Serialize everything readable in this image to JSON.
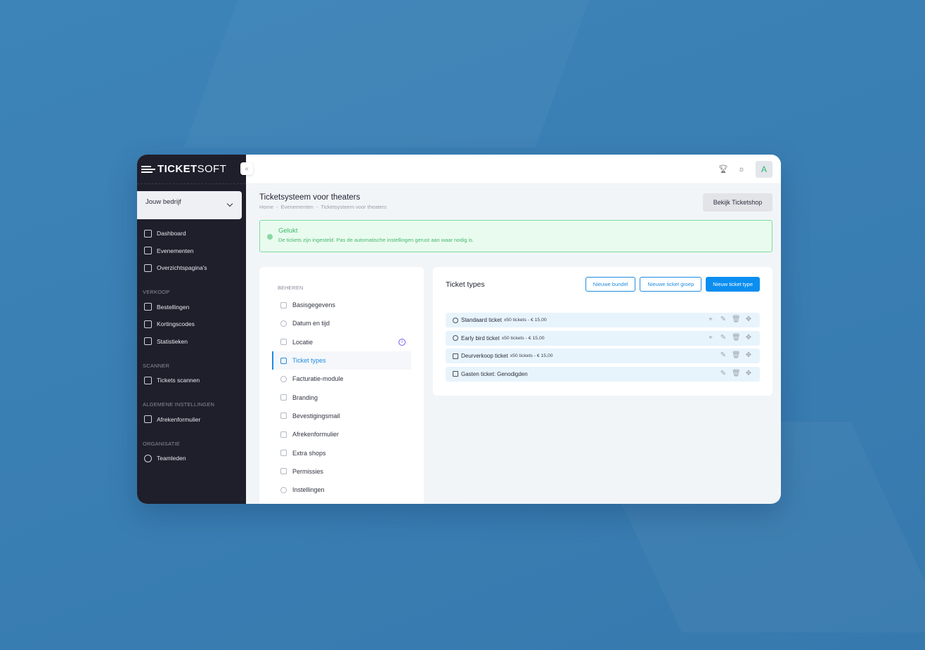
{
  "app": {
    "logo_bold": "TICKET",
    "logo_light": "SOFT",
    "company_selector": "Jouw bedrijf",
    "avatar_letter": "A"
  },
  "sidebar": {
    "main_items": [
      {
        "label": "Dashboard",
        "icon": "grid-icon"
      },
      {
        "label": "Evenementen",
        "icon": "calendar-icon"
      },
      {
        "label": "Overzichtspagina's",
        "icon": "scroll-icon"
      }
    ],
    "sections": [
      {
        "title": "VERKOOP",
        "items": [
          {
            "label": "Bestellingen",
            "icon": "basket-icon"
          },
          {
            "label": "Kortingscodes",
            "icon": "discount-icon"
          },
          {
            "label": "Statistieken",
            "icon": "chart-icon"
          }
        ]
      },
      {
        "title": "SCANNER",
        "items": [
          {
            "label": "Tickets scannen",
            "icon": "scan-icon"
          }
        ]
      },
      {
        "title": "ALGEMENE INSTELLINGEN",
        "items": [
          {
            "label": "Afrekenformulier",
            "icon": "list-icon"
          }
        ]
      },
      {
        "title": "ORGANISATIE",
        "items": [
          {
            "label": "Teamleden",
            "icon": "team-icon"
          }
        ]
      }
    ]
  },
  "header": {
    "title": "Ticketsysteem voor theaters",
    "breadcrumb": [
      "Home",
      "Evenementen",
      "Ticketsysteem voor theaters"
    ],
    "shop_button": "Bekijk Ticketshop"
  },
  "alert": {
    "title": "Gelukt",
    "text": "De tickets zijn ingesteld. Pas de automatische instellingen gerust aan waar nodig is."
  },
  "manage_menu": {
    "section": "BEHEREN",
    "items": [
      {
        "label": "Basisgegevens",
        "icon": "doc-icon"
      },
      {
        "label": "Datum en tijd",
        "icon": "clock-icon"
      },
      {
        "label": "Locatie",
        "icon": "map-icon",
        "info_badge": "i"
      },
      {
        "label": "Ticket types",
        "icon": "ticket-icon",
        "active": true
      },
      {
        "label": "Facturatie-module",
        "icon": "invoice-icon"
      },
      {
        "label": "Branding",
        "icon": "brush-icon"
      },
      {
        "label": "Bevestigingsmail",
        "icon": "mail-icon"
      },
      {
        "label": "Afrekenformulier",
        "icon": "form-icon"
      },
      {
        "label": "Extra shops",
        "icon": "shops-icon"
      },
      {
        "label": "Permissies",
        "icon": "lock-icon"
      },
      {
        "label": "Instellingen",
        "icon": "gear-icon"
      }
    ]
  },
  "ticket_types": {
    "title": "Ticket types",
    "buttons": {
      "new_bundle": "Nieuwe bundel",
      "new_group": "Nieuwe ticket groep",
      "new_type": "Nieuw ticket type"
    },
    "rows": [
      {
        "name": "Standaard ticket",
        "detail": "x50 tickets - € 15,00",
        "icon": "clock-icon",
        "has_location": true
      },
      {
        "name": "Early bird ticket",
        "detail": "x50 tickets - € 15,00",
        "icon": "clock-icon",
        "has_location": true
      },
      {
        "name": "Deurverkoop ticket",
        "detail": "x50 tickets - € 15,00",
        "icon": "door-icon",
        "has_location": false
      },
      {
        "name": "Gasten ticket: Genodigden",
        "detail": "",
        "icon": "guest-icon",
        "has_location": false
      }
    ]
  },
  "colors": {
    "sidebar_bg": "#1f1e2b",
    "accent": "#1f8ce0",
    "success": "#3db968",
    "page_bg": "#3a7fb4"
  }
}
